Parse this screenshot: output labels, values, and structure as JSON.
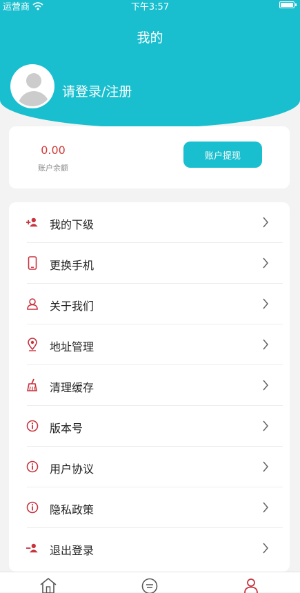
{
  "status_bar": {
    "carrier": "运营商",
    "time": "下午3:57"
  },
  "header": {
    "title": "我的",
    "login_text": "请登录/注册"
  },
  "balance": {
    "amount": "0.00",
    "label": "账户余额",
    "withdraw_label": "账户提现"
  },
  "menu": {
    "items": [
      {
        "label": "我的下级",
        "icon": "add-user-icon"
      },
      {
        "label": "更换手机",
        "icon": "phone-icon"
      },
      {
        "label": "关于我们",
        "icon": "person-icon"
      },
      {
        "label": "地址管理",
        "icon": "location-icon"
      },
      {
        "label": "清理缓存",
        "icon": "broom-icon"
      },
      {
        "label": "版本号",
        "icon": "info-icon"
      },
      {
        "label": "用户协议",
        "icon": "info-icon"
      },
      {
        "label": "隐私政策",
        "icon": "info-icon"
      },
      {
        "label": "退出登录",
        "icon": "logout-user-icon"
      }
    ]
  },
  "tabbar": {
    "tabs": [
      {
        "icon": "home-icon"
      },
      {
        "icon": "message-icon"
      },
      {
        "icon": "profile-icon",
        "active": true
      }
    ]
  },
  "colors": {
    "accent": "#19bfcf",
    "icon_red": "#c8333d",
    "amount_red": "#d23a3a"
  }
}
